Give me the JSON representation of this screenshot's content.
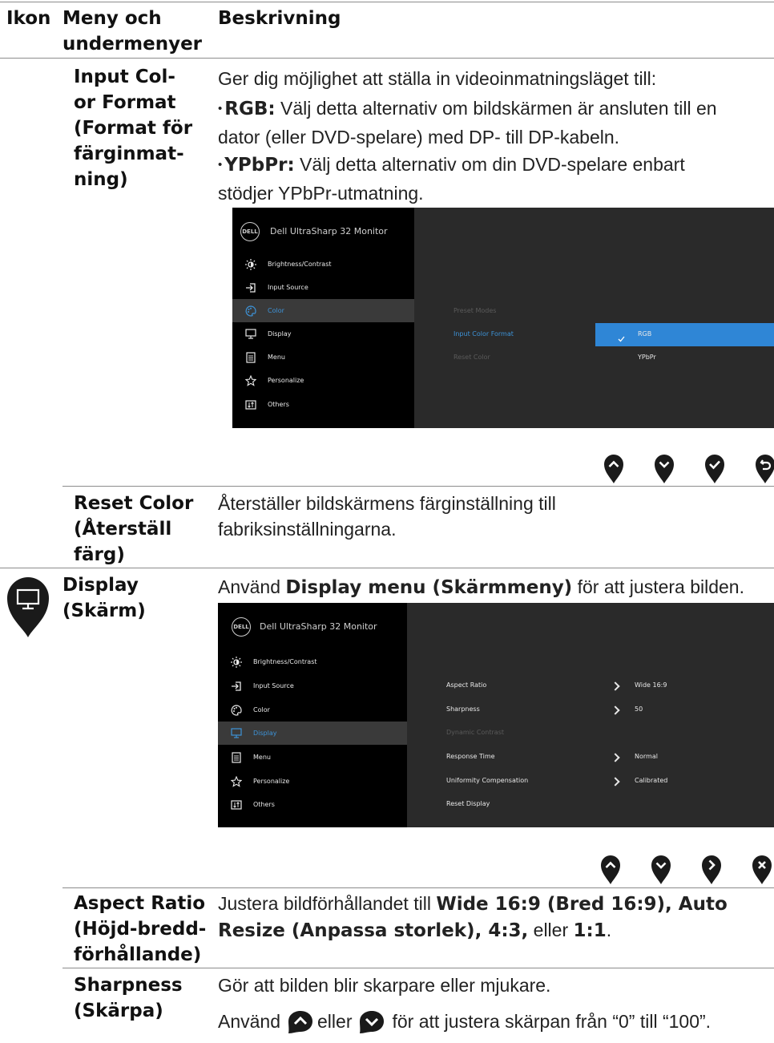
{
  "header": {
    "col_icon": "Ikon",
    "col_menu_1": "Meny och",
    "col_menu_2": "undermenyer",
    "col_desc": "Beskrivning"
  },
  "input_color_format": {
    "label_lines": [
      "Input Col-",
      "or Format",
      "(Format för",
      "färginmat-",
      "ning)"
    ],
    "intro": "Ger dig möjlighet att ställa in videoinmatningsläget till:",
    "rgb_term": "RGB:",
    "rgb_text_1": " Välj detta alternativ om bildskärmen är ansluten till en",
    "rgb_text_2": "dator (eller DVD-spelare) med DP- till DP-kabeln.",
    "ypbpr_term": "YPbPr:",
    "ypbpr_text_1": " Välj detta alternativ om din DVD-spelare enbart",
    "ypbpr_text_2": "stödjer YPbPr-utmatning."
  },
  "osd1": {
    "logo": "DELL",
    "title": "Dell UltraSharp 32 Monitor",
    "menu": [
      "Brightness/Contrast",
      "Input Source",
      "Color",
      "Display",
      "Menu",
      "Personalize",
      "Others"
    ],
    "selected_menu": "Color",
    "submenu": [
      "Preset Modes",
      "Input Color Format",
      "Reset Color"
    ],
    "options": [
      "RGB",
      "YPbPr"
    ],
    "selected_option": "RGB",
    "highlight_color": "#2f86d6"
  },
  "nav1": [
    "up-icon",
    "down-icon",
    "check-icon",
    "back-icon"
  ],
  "reset_color": {
    "label_lines": [
      "Reset Color",
      "(Återställ",
      "färg)"
    ],
    "text_1": "Återställer bildskärmens färginställning till",
    "text_2": "fabriksinställningarna."
  },
  "display": {
    "label_lines": [
      "Display",
      "(Skärm)"
    ],
    "text_pre": "Använd ",
    "text_bold": "Display menu (Skärmmeny)",
    "text_post": " för att justera bilden."
  },
  "osd2": {
    "logo": "DELL",
    "title": "Dell UltraSharp 32 Monitor",
    "menu": [
      "Brightness/Contrast",
      "Input Source",
      "Color",
      "Display",
      "Menu",
      "Personalize",
      "Others"
    ],
    "selected_menu": "Display",
    "submenu": [
      {
        "label": "Aspect Ratio",
        "value": "Wide 16:9"
      },
      {
        "label": "Sharpness",
        "value": "50"
      },
      {
        "label": "Dynamic Contrast",
        "value": ""
      },
      {
        "label": "Response Time",
        "value": "Normal"
      },
      {
        "label": "Uniformity Compensation",
        "value": "Calibrated"
      },
      {
        "label": "Reset Display",
        "value": ""
      }
    ]
  },
  "nav2": [
    "up-icon",
    "down-icon",
    "right-icon",
    "close-icon"
  ],
  "aspect_ratio": {
    "label_lines": [
      "Aspect Ratio",
      "(Höjd-bredd-",
      "förhållande)"
    ],
    "text_pre": "Justera bildförhållandet till ",
    "bold_1": "Wide 16:9 (Bred 16:9), Auto",
    "bold_2": "Resize (Anpassa storlek), 4:3,",
    "mid": " eller ",
    "bold_3": "1:1",
    "end": "."
  },
  "sharpness": {
    "label_lines": [
      "Sharpness",
      "(Skärpa)"
    ],
    "text_1": "Gör att bilden blir skarpare eller mjukare.",
    "use": "Använd",
    "or": "eller",
    "rest": "för att justera skärpan från “0” till “100”."
  },
  "colors": {
    "pin": "#1a1a1a",
    "osd_bg": "#2a2a2a",
    "osd_left": "#000000",
    "osd_blue": "#3d93d8"
  }
}
